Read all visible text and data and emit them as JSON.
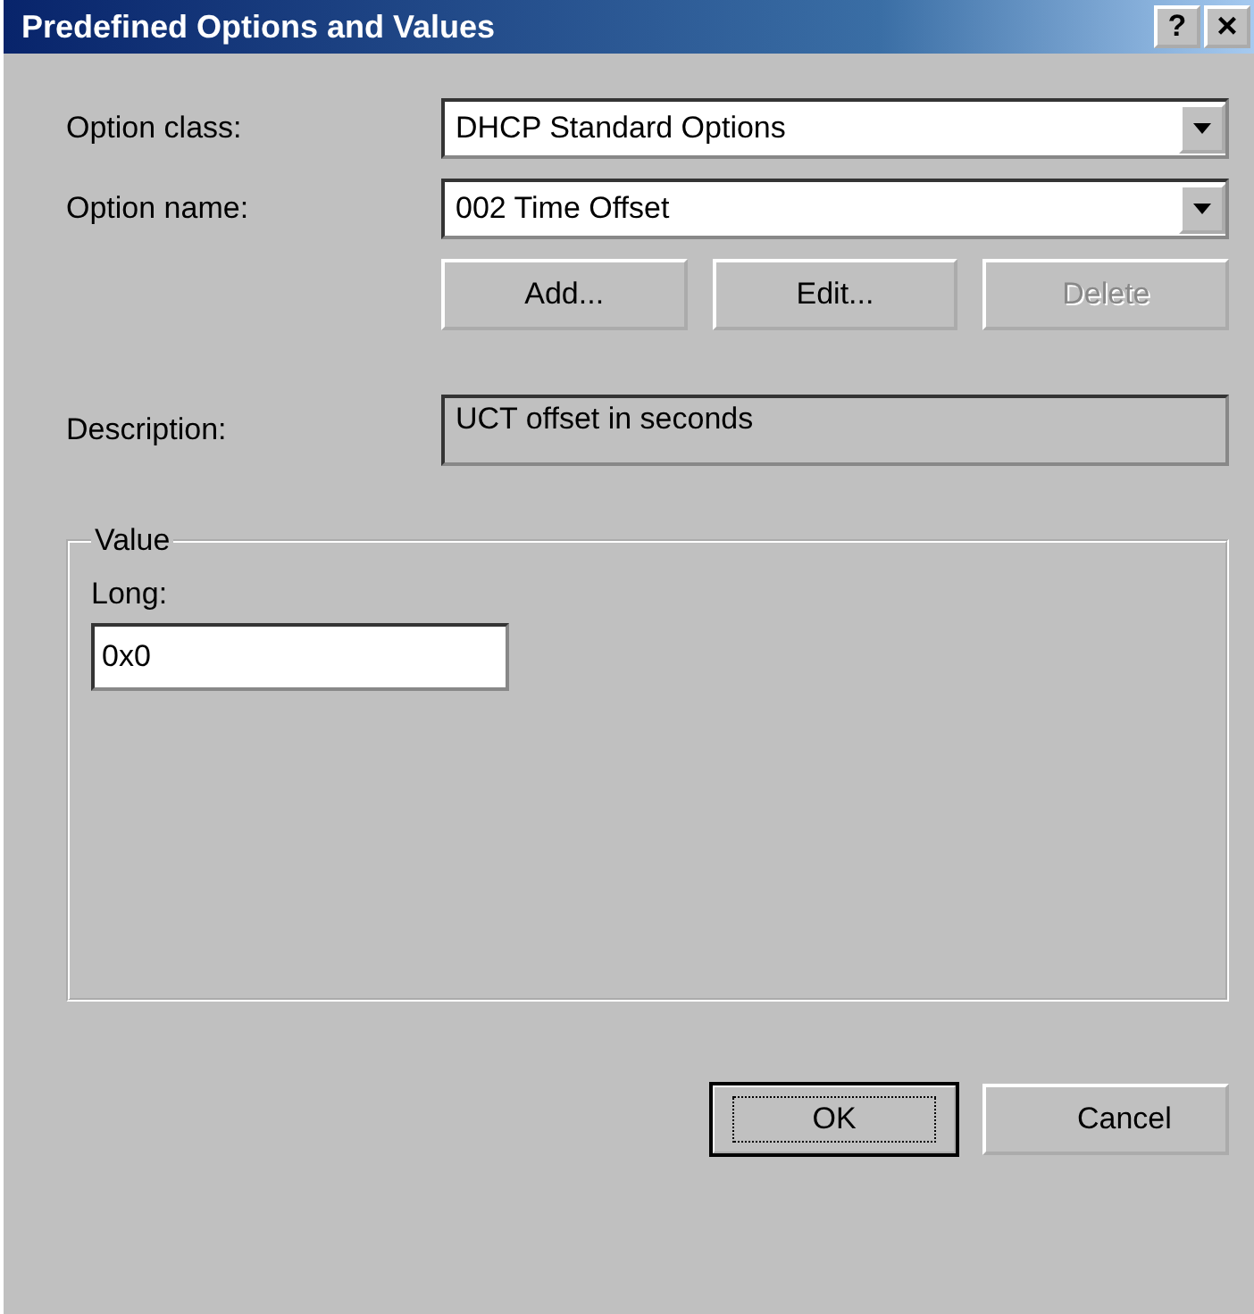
{
  "window": {
    "title": "Predefined Options and Values",
    "buttons": [
      {
        "kind": "help",
        "label": "?"
      },
      {
        "kind": "close",
        "label": "×"
      }
    ]
  },
  "option_class": {
    "label": "Option class:",
    "value": "DHCP Standard Options"
  },
  "option_name": {
    "label": "Option name:",
    "value": "002 Time Offset"
  },
  "option_buttons": [
    {
      "label": "Add...",
      "disabled": false
    },
    {
      "label": "Edit...",
      "disabled": false
    },
    {
      "label": "Delete",
      "disabled": true
    }
  ],
  "description": {
    "label": "Description:",
    "value": "UCT offset in seconds"
  },
  "value_group": {
    "title": "Value",
    "field_label": "Long:",
    "field_value": "0x0"
  },
  "dialog_buttons": [
    {
      "label": "OK",
      "default": true
    },
    {
      "label": "Cancel",
      "default": false
    }
  ]
}
